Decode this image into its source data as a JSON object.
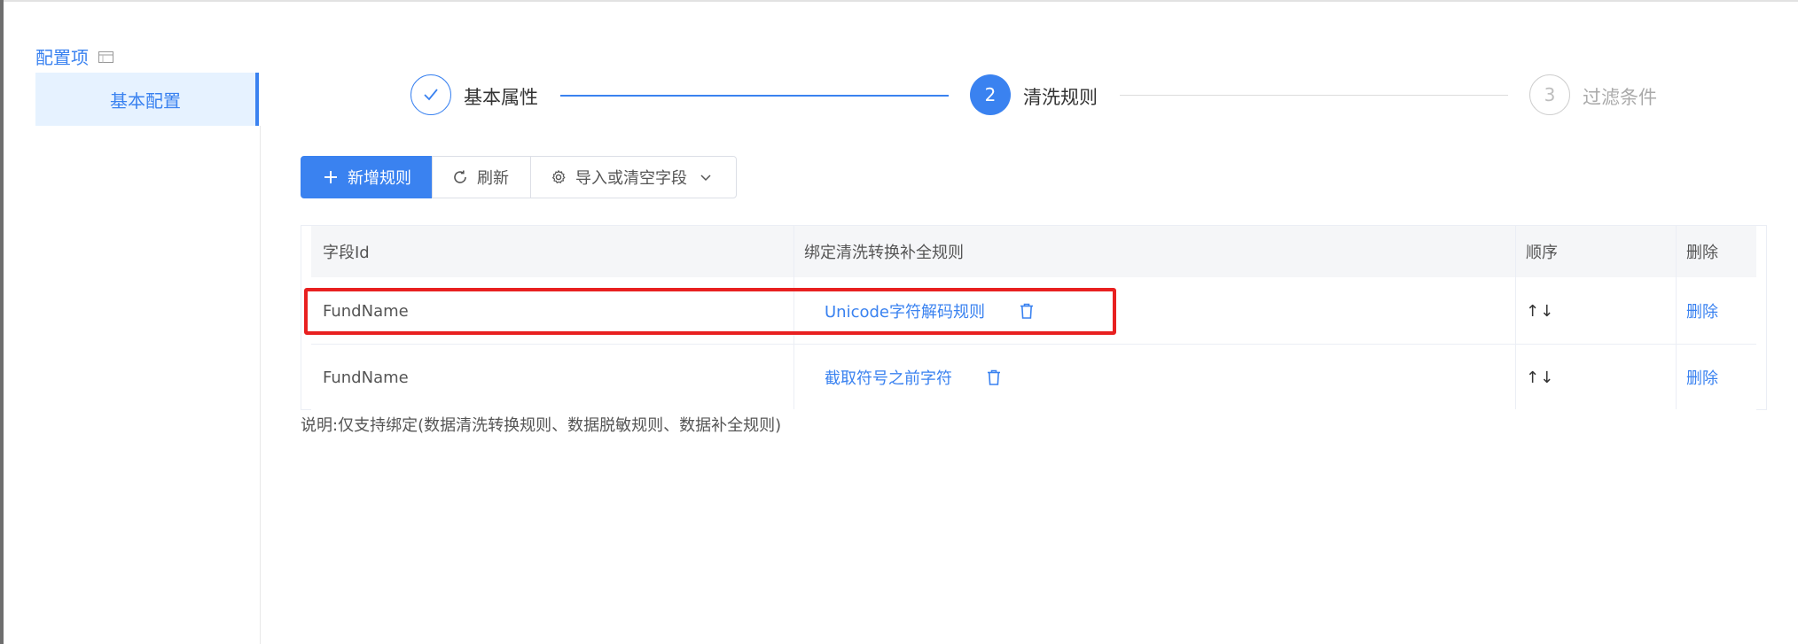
{
  "sidebar": {
    "title": "配置项",
    "items": [
      {
        "label": "基本配置",
        "active": true
      }
    ]
  },
  "steps": [
    {
      "label": "基本属性",
      "state": "done",
      "icon": "check-icon"
    },
    {
      "label": "清洗规则",
      "state": "active",
      "number": "2"
    },
    {
      "label": "过滤条件",
      "state": "pending",
      "number": "3"
    }
  ],
  "toolbar": {
    "add_label": "新增规则",
    "refresh_label": "刷新",
    "import_label": "导入或清空字段"
  },
  "table": {
    "columns": [
      "字段Id",
      "绑定清洗转换补全规则",
      "顺序",
      "删除"
    ],
    "rows": [
      {
        "field_id": "FundName",
        "rule": "Unicode字符解码规则",
        "order": "↑↓",
        "delete": "删除"
      },
      {
        "field_id": "FundName",
        "rule": "截取符号之前字符",
        "order": "↑↓",
        "delete": "删除"
      }
    ]
  },
  "note": "说明:仅支持绑定(数据清洗转换规则、数据脱敏规则、数据补全规则)",
  "colors": {
    "accent": "#3a82f0",
    "highlight": "#e82020"
  }
}
